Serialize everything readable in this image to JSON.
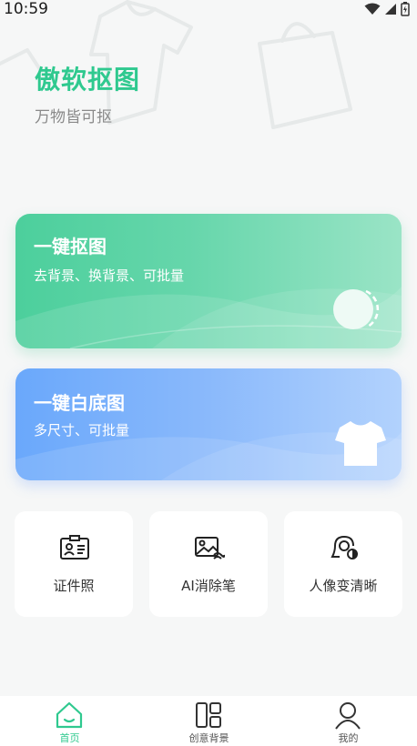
{
  "status_bar": {
    "time": "10:59"
  },
  "header": {
    "title": "傲软抠图",
    "subtitle": "万物皆可抠"
  },
  "cards": [
    {
      "title": "一键抠图",
      "subtitle": "去背景、换背景、可批量"
    },
    {
      "title": "一键白底图",
      "subtitle": "多尺寸、可批量"
    }
  ],
  "tools": [
    {
      "label": "证件照",
      "icon": "id-card-icon"
    },
    {
      "label": "AI消除笔",
      "icon": "image-eraser-icon"
    },
    {
      "label": "人像变清晰",
      "icon": "portrait-enhance-icon"
    }
  ],
  "tabbar": {
    "active": "首页",
    "tabs": [
      {
        "label": "首页",
        "icon": "home-icon"
      },
      {
        "label": "创意背景",
        "icon": "layout-grid-icon"
      },
      {
        "label": "我的",
        "icon": "user-icon"
      }
    ]
  },
  "colors": {
    "brand_green": "#2fc98f",
    "card_blue": "#6aa8fb",
    "background": "#f6f7f7"
  }
}
